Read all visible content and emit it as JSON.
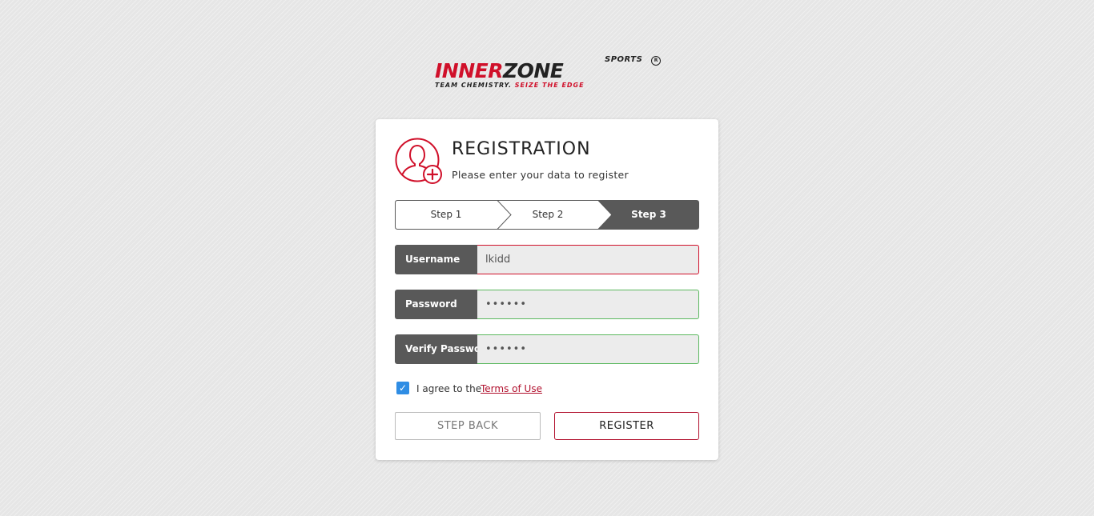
{
  "logo": {
    "inner": "INNER",
    "zone": "ZONE",
    "sports": "SPORTS",
    "reg": "R",
    "tagline_part1": "TEAM CHEMISTRY.",
    "tagline_part2": "SEIZE THE EDGE"
  },
  "form": {
    "title": "REGISTRATION",
    "subtitle": "Please enter your data to register",
    "steps": [
      {
        "label": "Step 1",
        "active": false
      },
      {
        "label": "Step 2",
        "active": false
      },
      {
        "label": "Step 3",
        "active": true
      }
    ],
    "fields": {
      "username": {
        "label": "Username",
        "value": "lkidd",
        "status": "error"
      },
      "password": {
        "label": "Password",
        "value": "••••••",
        "status": "valid"
      },
      "verify_password": {
        "label": "Verify Password",
        "value": "••••••",
        "status": "valid"
      }
    },
    "agree": {
      "checked": true,
      "text": "I agree to the",
      "link": "Terms of Use"
    },
    "buttons": {
      "back": "STEP BACK",
      "register": "REGISTER"
    }
  },
  "colors": {
    "brand_red": "#d0102a",
    "dark_gray": "#595959",
    "valid_green": "#5bb85f",
    "checkbox_blue": "#2f8de4"
  }
}
